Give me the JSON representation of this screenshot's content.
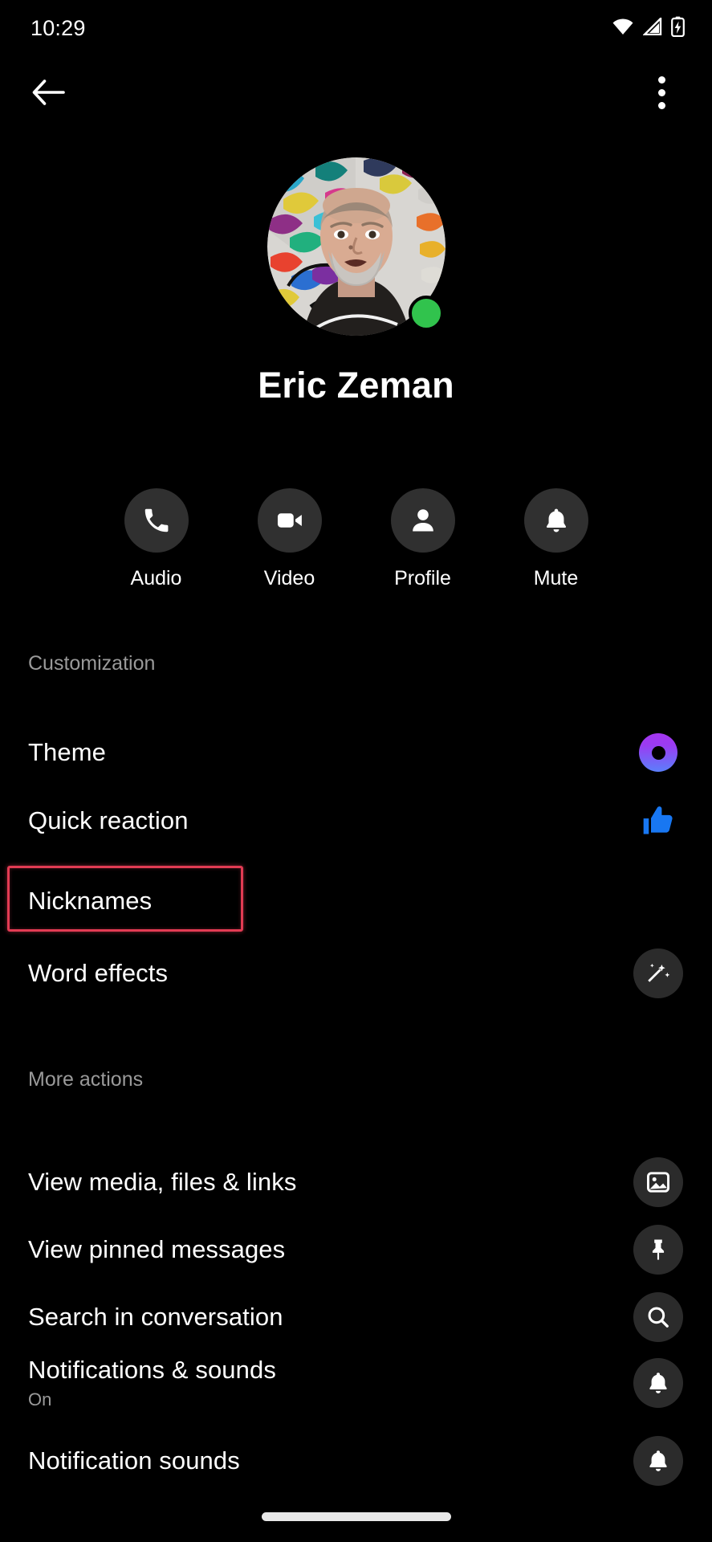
{
  "status_bar": {
    "time": "10:29",
    "icons": [
      "wifi-icon",
      "cellular-signal-icon",
      "battery-charging-icon"
    ]
  },
  "app_bar": {
    "back_icon": "back-arrow-icon",
    "overflow_icon": "more-options-icon"
  },
  "profile": {
    "name": "Eric Zeman",
    "avatar_alt": "avatar-photo",
    "presence": "online",
    "presence_color": "#31C34D"
  },
  "quick_actions": [
    {
      "label": "Audio",
      "icon": "phone-icon"
    },
    {
      "label": "Video",
      "icon": "video-camera-icon"
    },
    {
      "label": "Profile",
      "icon": "person-icon"
    },
    {
      "label": "Mute",
      "icon": "bell-icon"
    }
  ],
  "sections": [
    {
      "title": "Customization",
      "rows": [
        {
          "label": "Theme",
          "sub": "",
          "icon": "theme-color-ring-icon",
          "accent": "#A436F0"
        },
        {
          "label": "Quick reaction",
          "sub": "",
          "icon": "thumbs-up-icon",
          "glyph": "👍"
        },
        {
          "label": "Nicknames",
          "sub": "",
          "icon": "none"
        },
        {
          "label": "Word effects",
          "sub": "",
          "icon": "magic-wand-icon"
        }
      ]
    },
    {
      "title": "More actions",
      "rows": [
        {
          "label": "View media, files & links",
          "sub": "",
          "icon": "image-icon"
        },
        {
          "label": "View pinned messages",
          "sub": "",
          "icon": "pin-icon"
        },
        {
          "label": "Search in conversation",
          "sub": "",
          "icon": "search-icon"
        },
        {
          "label": "Notifications & sounds",
          "sub": "On",
          "icon": "bell-icon"
        },
        {
          "label": "Notification sounds",
          "sub": "",
          "icon": "bell-icon"
        }
      ]
    }
  ],
  "highlight": {
    "target": "Nicknames",
    "color": "#E23B53"
  },
  "navigation": {
    "gesture_bar": "home-gesture-bar"
  }
}
